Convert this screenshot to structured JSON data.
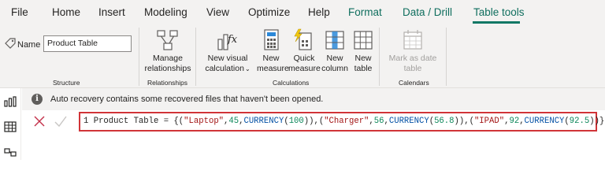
{
  "menu": {
    "items": [
      "File",
      "Home",
      "Insert",
      "Modeling",
      "View",
      "Optimize",
      "Help"
    ],
    "contextual": [
      "Format",
      "Data / Drill"
    ],
    "active": "Table tools"
  },
  "ribbon": {
    "structure": {
      "name_label": "Name",
      "name_value": "Product Table",
      "group_label": "Structure"
    },
    "relationships": {
      "manage_line1": "Manage",
      "manage_line2": "relationships",
      "group_label": "Relationships"
    },
    "calculations": {
      "new_visual_calc_line1": "New visual",
      "new_visual_calc_line2": "calculation",
      "new_measure_line1": "New",
      "new_measure_line2": "measure",
      "quick_measure_line1": "Quick",
      "quick_measure_line2": "measure",
      "new_column_line1": "New",
      "new_column_line2": "column",
      "new_table_line1": "New",
      "new_table_line2": "table",
      "group_label": "Calculations"
    },
    "calendars": {
      "mark_date_line1": "Mark as date",
      "mark_date_line2": "table",
      "group_label": "Calendars"
    }
  },
  "notification": {
    "text": "Auto recovery contains some recovered files that haven't been opened."
  },
  "formula": {
    "line_number": "1",
    "name": "Product Table",
    "equals": "=",
    "open": "{(",
    "item1_name": "\"Laptop\"",
    "item1_qty": "45",
    "item1_fn": "CURRENCY",
    "item1_price": "100",
    "item2_name": "\"Charger\"",
    "item2_qty": "56",
    "item2_fn": "CURRENCY",
    "item2_price": "56.8",
    "item3_name": "\"IPAD\"",
    "item3_qty": "92",
    "item3_fn": "CURRENCY",
    "item3_price": "92.5",
    "close": ")}"
  },
  "colors": {
    "accent_green": "#117865",
    "error_red": "#d13438"
  }
}
